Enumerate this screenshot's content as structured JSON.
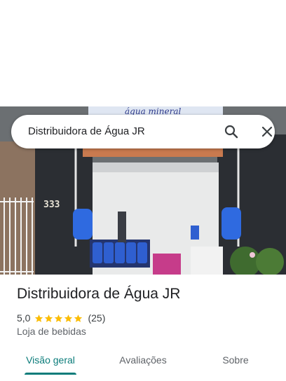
{
  "search": {
    "query": "Distribuidora de Água JR",
    "search_icon": "search-icon",
    "close_icon": "close-icon"
  },
  "photo": {
    "sign_text": "água mineral",
    "house_number": "333"
  },
  "place": {
    "title": "Distribuidora de Água JR",
    "rating": "5,0",
    "stars": 5,
    "review_count": "(25)",
    "category": "Loja de bebidas"
  },
  "tabs": [
    {
      "label": "Visão geral",
      "active": true
    },
    {
      "label": "Avaliações",
      "active": false
    },
    {
      "label": "Sobre",
      "active": false
    }
  ],
  "colors": {
    "accent": "#0b7c7a",
    "star": "#fbbc04",
    "text": "#202124"
  }
}
